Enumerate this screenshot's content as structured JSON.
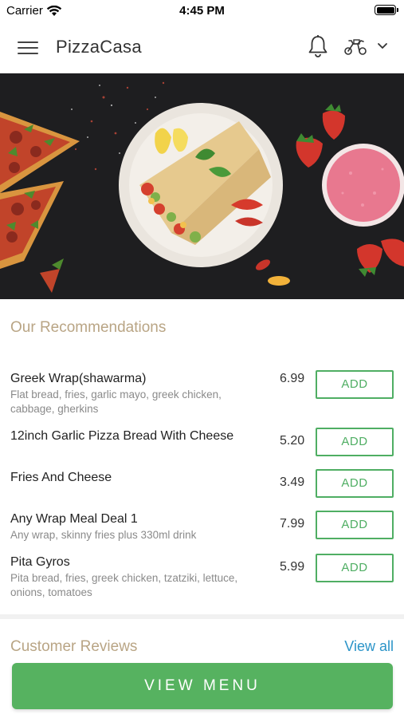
{
  "status_bar": {
    "carrier": "Carrier",
    "time": "4:45 PM"
  },
  "header": {
    "title": "PizzaCasa"
  },
  "recommendations": {
    "title": "Our Recommendations",
    "add_label": "ADD",
    "items": [
      {
        "name": "Greek Wrap(shawarma)",
        "description": "Flat bread, fries, garlic mayo, greek chicken, cabbage, gherkins",
        "price": "6.99"
      },
      {
        "name": "12inch Garlic Pizza Bread With Cheese",
        "description": "",
        "price": "5.20"
      },
      {
        "name": "Fries And Cheese",
        "description": "",
        "price": "3.49"
      },
      {
        "name": "Any Wrap Meal Deal 1",
        "description": "Any wrap, skinny fries plus 330ml drink",
        "price": "7.99"
      },
      {
        "name": "Pita Gyros",
        "description": "Pita bread, fries, greek chicken, tzatziki, lettuce, onions, tomatoes",
        "price": "5.99"
      }
    ]
  },
  "reviews": {
    "title": "Customer Reviews",
    "view_all_label": "View all"
  },
  "cta": {
    "view_menu_label": "VIEW MENU"
  },
  "colors": {
    "accent_green": "#56b260",
    "section_title": "#b9a585",
    "link_blue": "#2b94c8"
  }
}
